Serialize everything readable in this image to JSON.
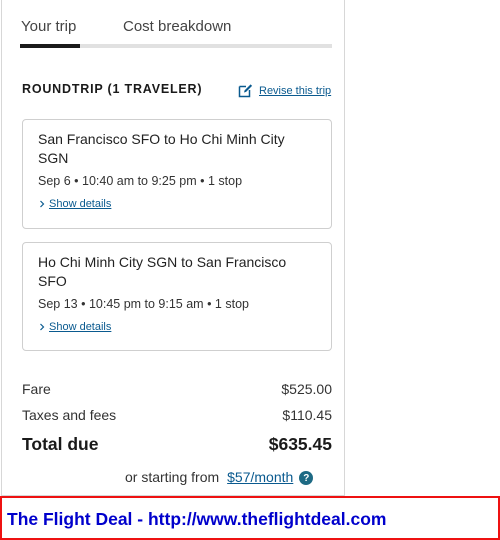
{
  "tabs": [
    {
      "label": "Your trip",
      "active": true
    },
    {
      "label": "Cost breakdown",
      "active": false
    }
  ],
  "trip": {
    "title": "ROUNDTRIP (1 TRAVELER)",
    "revise_label": "Revise this trip",
    "revise_icon": "edit-icon",
    "flights": [
      {
        "route": "San Francisco SFO to Ho Chi Minh City SGN",
        "times": "Sep 6 • 10:40 am to 9:25 pm • 1 stop",
        "details_label": "Show details"
      },
      {
        "route": "Ho Chi Minh City SGN to San Francisco SFO",
        "times": "Sep 13 • 10:45 pm to 9:15 am • 1 stop",
        "details_label": "Show details"
      }
    ]
  },
  "costs": {
    "fare_label": "Fare",
    "fare_value": "$525.00",
    "taxes_label": "Taxes and fees",
    "taxes_value": "$110.45",
    "total_label": "Total due",
    "total_value": "$635.45",
    "monthly_prefix": "or starting from",
    "monthly_link": "$57/month",
    "help_icon": "?"
  },
  "banner": {
    "text": "The Flight Deal - http://www.theflightdeal.com"
  },
  "colors": {
    "link": "#0a5a8f",
    "banner_border": "#ee1111",
    "banner_text": "#0000cc",
    "tab_indicator": "#1a1a1a"
  }
}
